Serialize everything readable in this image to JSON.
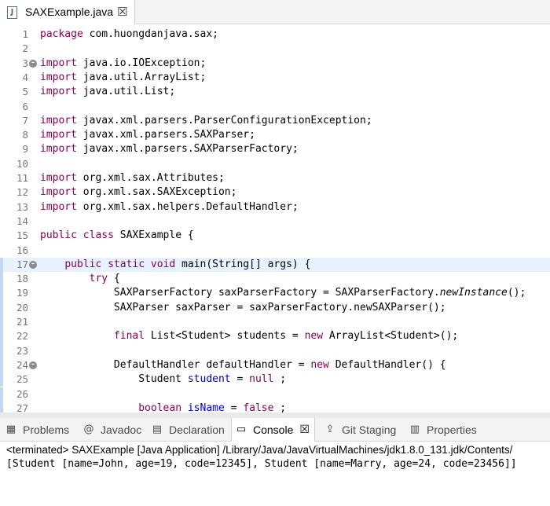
{
  "editor_tab": {
    "icon": "J",
    "title": "SAXExample.java",
    "close": "☒"
  },
  "lines": [
    {
      "n": "1",
      "segs": [
        [
          "kw",
          "package"
        ],
        [
          "",
          "com.huongdanjava.sax;"
        ]
      ]
    },
    {
      "n": "2",
      "segs": []
    },
    {
      "n": "3",
      "fold": true,
      "segs": [
        [
          "kw",
          "import"
        ],
        [
          "",
          "java.io.IOException;"
        ]
      ]
    },
    {
      "n": "4",
      "segs": [
        [
          "kw",
          "import"
        ],
        [
          "",
          "java.util.ArrayList;"
        ]
      ]
    },
    {
      "n": "5",
      "segs": [
        [
          "kw",
          "import"
        ],
        [
          "",
          "java.util.List;"
        ]
      ]
    },
    {
      "n": "6",
      "segs": []
    },
    {
      "n": "7",
      "segs": [
        [
          "kw",
          "import"
        ],
        [
          "",
          "javax.xml.parsers.ParserConfigurationException;"
        ]
      ]
    },
    {
      "n": "8",
      "segs": [
        [
          "kw",
          "import"
        ],
        [
          "",
          "javax.xml.parsers.SAXParser;"
        ]
      ]
    },
    {
      "n": "9",
      "segs": [
        [
          "kw",
          "import"
        ],
        [
          "",
          "javax.xml.parsers.SAXParserFactory;"
        ]
      ]
    },
    {
      "n": "10",
      "segs": []
    },
    {
      "n": "11",
      "segs": [
        [
          "kw",
          "import"
        ],
        [
          "",
          "org.xml.sax.Attributes;"
        ]
      ]
    },
    {
      "n": "12",
      "segs": [
        [
          "kw",
          "import"
        ],
        [
          "",
          "org.xml.sax.SAXException;"
        ]
      ]
    },
    {
      "n": "13",
      "segs": [
        [
          "kw",
          "import"
        ],
        [
          "",
          "org.xml.sax.helpers.DefaultHandler;"
        ]
      ]
    },
    {
      "n": "14",
      "segs": []
    },
    {
      "n": "15",
      "segs": [
        [
          "kw",
          "public class"
        ],
        [
          "",
          "SAXExample {"
        ]
      ]
    },
    {
      "n": "16",
      "segs": []
    },
    {
      "n": "17",
      "fold": true,
      "current": true,
      "marker": true,
      "segs": [
        [
          "",
          "    "
        ],
        [
          "kw",
          "public static void"
        ],
        [
          "",
          "main(String[] args) {"
        ]
      ]
    },
    {
      "n": "18",
      "marker": true,
      "segs": [
        [
          "",
          "        "
        ],
        [
          "kw",
          "try"
        ],
        [
          "",
          "{"
        ]
      ]
    },
    {
      "n": "19",
      "marker": true,
      "segs": [
        [
          "",
          "            SAXParserFactory saxParserFactory = SAXParserFactory."
        ],
        [
          "it",
          "newInstance"
        ],
        [
          "",
          "();"
        ]
      ]
    },
    {
      "n": "20",
      "marker": true,
      "segs": [
        [
          "",
          "            SAXParser saxParser = saxParserFactory.newSAXParser();"
        ]
      ]
    },
    {
      "n": "21",
      "marker": true,
      "segs": []
    },
    {
      "n": "22",
      "marker": true,
      "segs": [
        [
          "",
          "            "
        ],
        [
          "kw",
          "final"
        ],
        [
          "",
          "List<Student> students = "
        ],
        [
          "kw",
          "new"
        ],
        [
          "",
          "ArrayList<Student>();"
        ]
      ]
    },
    {
      "n": "23",
      "marker": true,
      "segs": []
    },
    {
      "n": "24",
      "fold": true,
      "marker": true,
      "segs": [
        [
          "",
          "            DefaultHandler defaultHandler = "
        ],
        [
          "kw",
          "new"
        ],
        [
          "",
          "DefaultHandler() {"
        ]
      ]
    },
    {
      "n": "25",
      "marker": true,
      "segs": [
        [
          "",
          "                Student "
        ],
        [
          "fld",
          "student"
        ],
        [
          "",
          " = "
        ],
        [
          "kw",
          "null"
        ],
        [
          "",
          ";"
        ]
      ]
    },
    {
      "n": "26",
      "marker": true,
      "segs": []
    },
    {
      "n": "27",
      "marker": true,
      "segs": [
        [
          "",
          "                "
        ],
        [
          "kw",
          "boolean"
        ],
        [
          "",
          ""
        ],
        [
          "fld",
          "isName"
        ],
        [
          "",
          " = "
        ],
        [
          "kw",
          "false"
        ],
        [
          "",
          ";"
        ]
      ]
    }
  ],
  "panel_tabs": [
    {
      "name": "problems",
      "icon": "▦",
      "icon_name": "problems-icon",
      "label": "Problems"
    },
    {
      "name": "javadoc",
      "icon": "@",
      "icon_name": "javadoc-icon",
      "label": "Javadoc"
    },
    {
      "name": "declaration",
      "icon": "▤",
      "icon_name": "declaration-icon",
      "label": "Declaration"
    },
    {
      "name": "console",
      "icon": "▭",
      "icon_name": "console-icon",
      "label": "Console",
      "active": true,
      "close": "☒"
    },
    {
      "name": "git-staging",
      "icon": "⇪",
      "icon_name": "git-staging-icon",
      "label": "Git Staging"
    },
    {
      "name": "properties",
      "icon": "▥",
      "icon_name": "properties-icon",
      "label": "Properties"
    }
  ],
  "console": {
    "header": "<terminated> SAXExample [Java Application] /Library/Java/JavaVirtualMachines/jdk1.8.0_131.jdk/Contents/",
    "output": "[Student [name=John, age=19, code=12345], Student [name=Marry, age=24, code=23456]]"
  },
  "colors": {
    "keyword": "#7f0055",
    "field": "#0000c0",
    "current_line": "#e8f2fe",
    "line_number": "#787878"
  }
}
